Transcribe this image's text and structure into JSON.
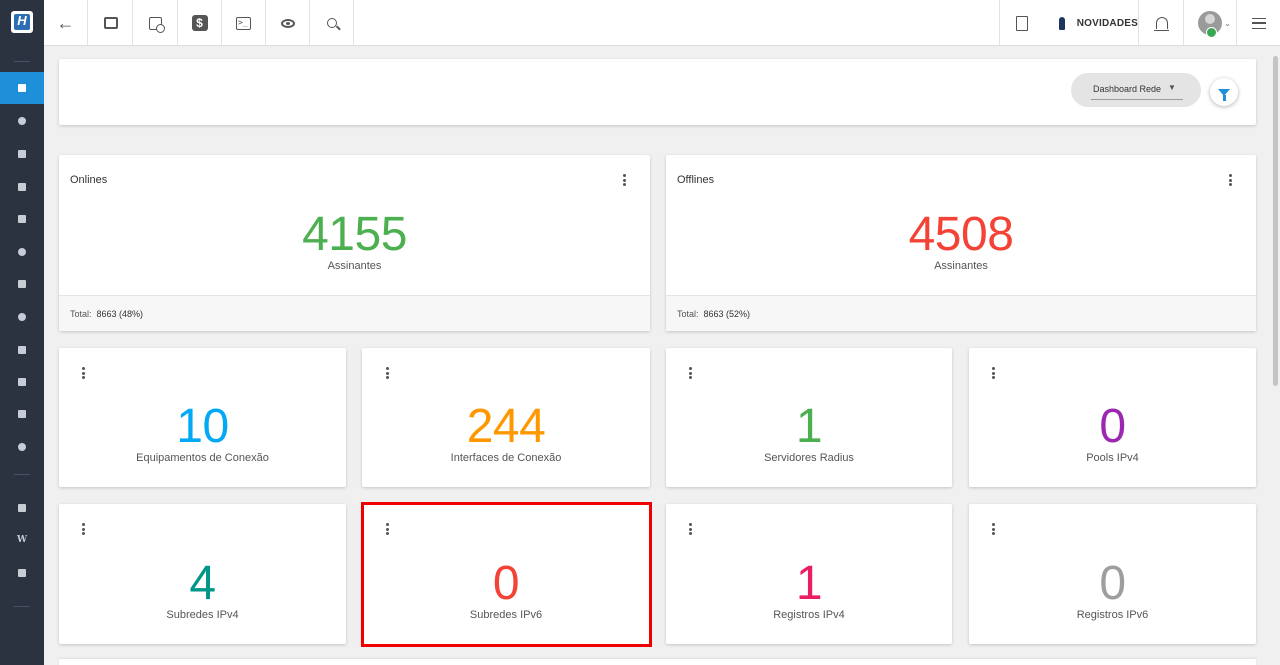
{
  "topbar": {
    "novidades_label": "NOVIDADES"
  },
  "filter": {
    "dashboard_select": "Dashboard Rede"
  },
  "status_cards": [
    {
      "title": "Onlines",
      "value": "4155",
      "label": "Assinantes",
      "total_label": "Total:",
      "total_value": "8663 (48%)",
      "color": "#4caf50"
    },
    {
      "title": "Offlines",
      "value": "4508",
      "label": "Assinantes",
      "total_label": "Total:",
      "total_value": "8663 (52%)",
      "color": "#f44336"
    }
  ],
  "metric_cards": [
    {
      "value": "10",
      "label": "Equipamentos de Conexão",
      "color": "#03a9f4"
    },
    {
      "value": "244",
      "label": "Interfaces de Conexão",
      "color": "#ff9800"
    },
    {
      "value": "1",
      "label": "Servidores Radius",
      "color": "#4caf50"
    },
    {
      "value": "0",
      "label": "Pools IPv4",
      "color": "#9c27b0"
    },
    {
      "value": "4",
      "label": "Subredes IPv4",
      "color": "#009688"
    },
    {
      "value": "0",
      "label": "Subredes IPv6",
      "color": "#f44336"
    },
    {
      "value": "1",
      "label": "Registros IPv4",
      "color": "#e91e63"
    },
    {
      "value": "0",
      "label": "Registros IPv6",
      "color": "#9e9e9e"
    }
  ],
  "icons": {
    "sidebar": [
      "dashboard-icon",
      "network-icon",
      "contacts-icon",
      "board-icon",
      "schedule-icon",
      "package-icon",
      "money-icon",
      "map-pin-icon",
      "document-icon",
      "server-icon",
      "file-icon",
      "settings-icon",
      "youtube-icon",
      "wiki-icon",
      "chat-icon"
    ],
    "topbar": [
      "back-icon",
      "contact-card-icon",
      "calendar-clock-icon",
      "dollar-icon",
      "terminal-icon",
      "eye-icon",
      "search-icon",
      "pdf-icon",
      "notification-bell-icon",
      "bell-icon",
      "avatar",
      "list-icon"
    ]
  },
  "colors": {
    "sidebar_bg": "#2b3240",
    "accent": "#1e90d9",
    "highlight_border": "#f00000"
  }
}
